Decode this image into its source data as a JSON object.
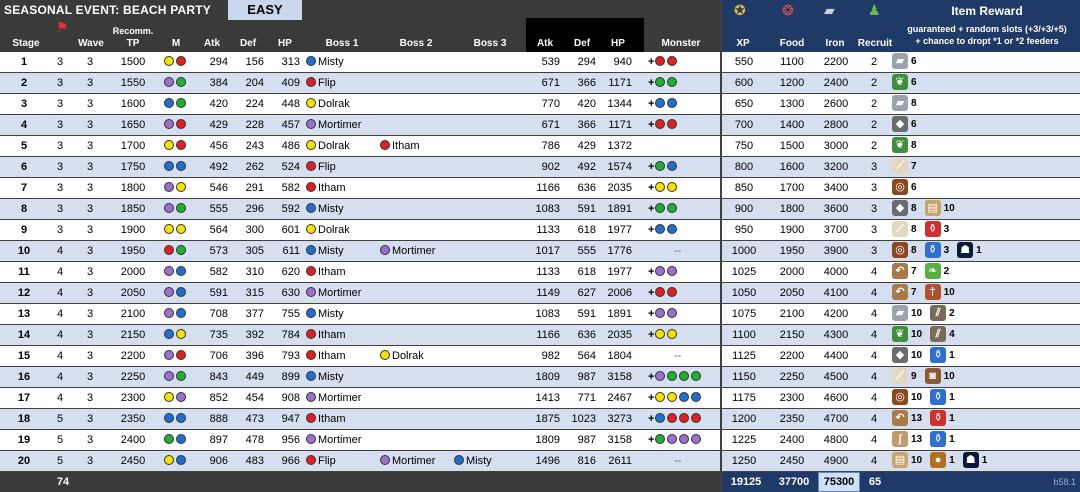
{
  "header": {
    "title": "SEASONAL EVENT:  BEACH PARTY",
    "difficulty": "EASY",
    "columns": {
      "stage": "Stage",
      "wave": "Wave",
      "recomm_top": "Recomm.",
      "recomm_bottom": "TP",
      "m": "M",
      "atk": "Atk",
      "def": "Def",
      "hp": "HP",
      "boss1": "Boss 1",
      "boss2": "Boss 2",
      "boss3": "Boss 3",
      "atk2": "Atk",
      "def2": "Def",
      "hp2": "HP",
      "monster": "Monster",
      "xp": "XP",
      "food": "Food",
      "iron": "Iron",
      "recruit": "Recruit",
      "item_reward": "Item Reward",
      "reward_note1": "guaranteed + random slots (+3/+3/+5)",
      "reward_note2": "+ chance to dropt *1 or *2 feeders"
    },
    "icons": [
      "xp-icon",
      "food-icon",
      "iron-icon",
      "recruit-icon",
      "stage-icon"
    ]
  },
  "colors": {
    "red": "#e02020",
    "green": "#20b030",
    "blue": "#1f6fd0",
    "yellow": "#f5e000",
    "purple": "#9b6fd0"
  },
  "rows": [
    {
      "stage": "1",
      "c1": "3",
      "wave": "3",
      "tp": "1500",
      "m": [
        "yellow",
        "red"
      ],
      "atk": "294",
      "def": "156",
      "hp": "313",
      "b1": {
        "n": "Misty",
        "c": "blue"
      },
      "b2": null,
      "b3": null,
      "atk2": "539",
      "def2": "294",
      "hp2": "940",
      "mon": [
        "red",
        "red"
      ],
      "mplus": true,
      "xp": "550",
      "food": "1100",
      "iron": "2200",
      "rec": "2",
      "items": [
        {
          "i": "iron-ore",
          "q": "6"
        }
      ]
    },
    {
      "stage": "2",
      "c1": "3",
      "wave": "3",
      "tp": "1550",
      "m": [
        "purple",
        "green"
      ],
      "atk": "384",
      "def": "204",
      "hp": "409",
      "b1": {
        "n": "Flip",
        "c": "red"
      },
      "b2": null,
      "b3": null,
      "atk2": "671",
      "def2": "366",
      "hp2": "1171",
      "mon": [
        "green",
        "green"
      ],
      "mplus": true,
      "xp": "600",
      "food": "1200",
      "iron": "2400",
      "rec": "2",
      "items": [
        {
          "i": "herb",
          "q": "6"
        }
      ]
    },
    {
      "stage": "3",
      "c1": "3",
      "wave": "3",
      "tp": "1600",
      "m": [
        "blue",
        "green"
      ],
      "atk": "420",
      "def": "224",
      "hp": "448",
      "b1": {
        "n": "Dolrak",
        "c": "yellow"
      },
      "b2": null,
      "b3": null,
      "atk2": "770",
      "def2": "420",
      "hp2": "1344",
      "mon": [
        "blue",
        "blue"
      ],
      "mplus": true,
      "xp": "650",
      "food": "1300",
      "iron": "2600",
      "rec": "2",
      "items": [
        {
          "i": "iron-ore",
          "q": "8"
        }
      ]
    },
    {
      "stage": "4",
      "c1": "3",
      "wave": "3",
      "tp": "1650",
      "m": [
        "purple",
        "red"
      ],
      "atk": "429",
      "def": "228",
      "hp": "457",
      "b1": {
        "n": "Mortimer",
        "c": "purple"
      },
      "b2": null,
      "b3": null,
      "atk2": "671",
      "def2": "366",
      "hp2": "1171",
      "mon": [
        "red",
        "red"
      ],
      "mplus": true,
      "xp": "700",
      "food": "1400",
      "iron": "2800",
      "rec": "2",
      "items": [
        {
          "i": "stone",
          "q": "6"
        }
      ]
    },
    {
      "stage": "5",
      "c1": "3",
      "wave": "3",
      "tp": "1700",
      "m": [
        "yellow",
        "red"
      ],
      "atk": "456",
      "def": "243",
      "hp": "486",
      "b1": {
        "n": "Dolrak",
        "c": "yellow"
      },
      "b2": {
        "n": "Itham",
        "c": "red"
      },
      "b3": null,
      "atk2": "786",
      "def2": "429",
      "hp2": "1372",
      "mon": [],
      "mplus": false,
      "xp": "750",
      "food": "1500",
      "iron": "3000",
      "rec": "2",
      "items": [
        {
          "i": "herb",
          "q": "8"
        }
      ]
    },
    {
      "stage": "6",
      "c1": "3",
      "wave": "3",
      "tp": "1750",
      "m": [
        "blue",
        "blue"
      ],
      "atk": "492",
      "def": "262",
      "hp": "524",
      "b1": {
        "n": "Flip",
        "c": "red"
      },
      "b2": null,
      "b3": null,
      "atk2": "902",
      "def2": "492",
      "hp2": "1574",
      "mon": [
        "green",
        "blue"
      ],
      "mplus": true,
      "xp": "800",
      "food": "1600",
      "iron": "3200",
      "rec": "3",
      "items": [
        {
          "i": "bone",
          "q": "7"
        }
      ]
    },
    {
      "stage": "7",
      "c1": "3",
      "wave": "3",
      "tp": "1800",
      "m": [
        "purple",
        "yellow"
      ],
      "atk": "546",
      "def": "291",
      "hp": "582",
      "b1": {
        "n": "Itham",
        "c": "red"
      },
      "b2": null,
      "b3": null,
      "atk2": "1166",
      "def2": "636",
      "hp2": "2035",
      "mon": [
        "yellow",
        "yellow"
      ],
      "mplus": true,
      "xp": "850",
      "food": "1700",
      "iron": "3400",
      "rec": "3",
      "items": [
        {
          "i": "ring",
          "q": "6"
        }
      ]
    },
    {
      "stage": "8",
      "c1": "3",
      "wave": "3",
      "tp": "1850",
      "m": [
        "purple",
        "green"
      ],
      "atk": "555",
      "def": "296",
      "hp": "592",
      "b1": {
        "n": "Misty",
        "c": "blue"
      },
      "b2": null,
      "b3": null,
      "atk2": "1083",
      "def2": "591",
      "hp2": "1891",
      "mon": [
        "green",
        "green"
      ],
      "mplus": true,
      "xp": "900",
      "food": "1800",
      "iron": "3600",
      "rec": "3",
      "items": [
        {
          "i": "stone",
          "q": "8"
        },
        {
          "i": "book",
          "q": "10"
        }
      ]
    },
    {
      "stage": "9",
      "c1": "3",
      "wave": "3",
      "tp": "1900",
      "m": [
        "yellow",
        "yellow"
      ],
      "atk": "564",
      "def": "300",
      "hp": "601",
      "b1": {
        "n": "Dolrak",
        "c": "yellow"
      },
      "b2": null,
      "b3": null,
      "atk2": "1133",
      "def2": "618",
      "hp2": "1977",
      "mon": [
        "blue",
        "blue"
      ],
      "mplus": true,
      "xp": "950",
      "food": "1900",
      "iron": "3700",
      "rec": "3",
      "items": [
        {
          "i": "bone",
          "q": "8"
        },
        {
          "i": "potion-red",
          "q": "3"
        }
      ]
    },
    {
      "stage": "10",
      "c1": "4",
      "wave": "3",
      "tp": "1950",
      "m": [
        "red",
        "green"
      ],
      "atk": "573",
      "def": "305",
      "hp": "611",
      "b1": {
        "n": "Misty",
        "c": "blue"
      },
      "b2": {
        "n": "Mortimer",
        "c": "purple"
      },
      "b3": null,
      "atk2": "1017",
      "def2": "555",
      "hp2": "1776",
      "mon": [],
      "mplus": false,
      "mdash": "--",
      "xp": "1000",
      "food": "1950",
      "iron": "3900",
      "rec": "3",
      "items": [
        {
          "i": "ring",
          "q": "8"
        },
        {
          "i": "potion-blue",
          "q": "3"
        },
        {
          "i": "hooded-figure",
          "q": "1"
        }
      ]
    },
    {
      "stage": "11",
      "c1": "4",
      "wave": "3",
      "tp": "2000",
      "m": [
        "purple",
        "blue"
      ],
      "atk": "582",
      "def": "310",
      "hp": "620",
      "b1": {
        "n": "Itham",
        "c": "red"
      },
      "b2": null,
      "b3": null,
      "atk2": "1133",
      "def2": "618",
      "hp2": "1977",
      "mon": [
        "purple",
        "purple"
      ],
      "mplus": true,
      "xp": "1025",
      "food": "2000",
      "iron": "4000",
      "rec": "4",
      "items": [
        {
          "i": "horn",
          "q": "7"
        },
        {
          "i": "leaves",
          "q": "2"
        }
      ]
    },
    {
      "stage": "12",
      "c1": "4",
      "wave": "3",
      "tp": "2050",
      "m": [
        "purple",
        "blue"
      ],
      "atk": "591",
      "def": "315",
      "hp": "630",
      "b1": {
        "n": "Mortimer",
        "c": "purple"
      },
      "b2": null,
      "b3": null,
      "atk2": "1149",
      "def2": "627",
      "hp2": "2006",
      "mon": [
        "red",
        "red"
      ],
      "mplus": true,
      "xp": "1050",
      "food": "2050",
      "iron": "4100",
      "rec": "4",
      "items": [
        {
          "i": "horn",
          "q": "7"
        },
        {
          "i": "dagger",
          "q": "10"
        }
      ]
    },
    {
      "stage": "13",
      "c1": "4",
      "wave": "3",
      "tp": "2100",
      "m": [
        "purple",
        "blue"
      ],
      "atk": "708",
      "def": "377",
      "hp": "755",
      "b1": {
        "n": "Misty",
        "c": "blue"
      },
      "b2": null,
      "b3": null,
      "atk2": "1083",
      "def2": "591",
      "hp2": "1891",
      "mon": [
        "purple",
        "purple"
      ],
      "mplus": true,
      "xp": "1075",
      "food": "2100",
      "iron": "4200",
      "rec": "4",
      "items": [
        {
          "i": "iron-ore",
          "q": "10"
        },
        {
          "i": "spears",
          "q": "2"
        }
      ]
    },
    {
      "stage": "14",
      "c1": "4",
      "wave": "3",
      "tp": "2150",
      "m": [
        "blue",
        "yellow"
      ],
      "atk": "735",
      "def": "392",
      "hp": "784",
      "b1": {
        "n": "Itham",
        "c": "red"
      },
      "b2": null,
      "b3": null,
      "atk2": "1166",
      "def2": "636",
      "hp2": "2035",
      "mon": [
        "yellow",
        "yellow"
      ],
      "mplus": true,
      "xp": "1100",
      "food": "2150",
      "iron": "4300",
      "rec": "4",
      "items": [
        {
          "i": "herb",
          "q": "10"
        },
        {
          "i": "spears",
          "q": "4"
        }
      ]
    },
    {
      "stage": "15",
      "c1": "4",
      "wave": "3",
      "tp": "2200",
      "m": [
        "purple",
        "red"
      ],
      "atk": "706",
      "def": "396",
      "hp": "793",
      "b1": {
        "n": "Itham",
        "c": "red"
      },
      "b2": {
        "n": "Dolrak",
        "c": "yellow"
      },
      "b3": null,
      "atk2": "982",
      "def2": "564",
      "hp2": "1804",
      "mon": [],
      "mplus": false,
      "mdash": "--",
      "xp": "1125",
      "food": "2200",
      "iron": "4400",
      "rec": "4",
      "items": [
        {
          "i": "stone",
          "q": "10"
        },
        {
          "i": "potion-blue",
          "q": "1"
        }
      ]
    },
    {
      "stage": "16",
      "c1": "4",
      "wave": "3",
      "tp": "2250",
      "m": [
        "purple",
        "green"
      ],
      "atk": "843",
      "def": "449",
      "hp": "899",
      "b1": {
        "n": "Misty",
        "c": "blue"
      },
      "b2": null,
      "b3": null,
      "atk2": "1809",
      "def2": "987",
      "hp2": "3158",
      "mon": [
        "purple",
        "green",
        "green",
        "green"
      ],
      "mplus": true,
      "xp": "1150",
      "food": "2250",
      "iron": "4500",
      "rec": "4",
      "items": [
        {
          "i": "bone",
          "q": "9"
        },
        {
          "i": "backpack",
          "q": "10"
        }
      ]
    },
    {
      "stage": "17",
      "c1": "4",
      "wave": "3",
      "tp": "2300",
      "m": [
        "yellow",
        "purple"
      ],
      "atk": "852",
      "def": "454",
      "hp": "908",
      "b1": {
        "n": "Mortimer",
        "c": "purple"
      },
      "b2": null,
      "b3": null,
      "atk2": "1413",
      "def2": "771",
      "hp2": "2467",
      "mon": [
        "yellow",
        "yellow",
        "blue",
        "blue"
      ],
      "mplus": true,
      "xp": "1175",
      "food": "2300",
      "iron": "4600",
      "rec": "4",
      "items": [
        {
          "i": "ring",
          "q": "10"
        },
        {
          "i": "potion-blue",
          "q": "1"
        }
      ]
    },
    {
      "stage": "18",
      "c1": "5",
      "wave": "3",
      "tp": "2350",
      "m": [
        "blue",
        "blue"
      ],
      "atk": "888",
      "def": "473",
      "hp": "947",
      "b1": {
        "n": "Itham",
        "c": "red"
      },
      "b2": null,
      "b3": null,
      "atk2": "1875",
      "def2": "1023",
      "hp2": "3273",
      "mon": [
        "blue",
        "red",
        "red",
        "red"
      ],
      "mplus": true,
      "xp": "1200",
      "food": "2350",
      "iron": "4700",
      "rec": "4",
      "items": [
        {
          "i": "horn",
          "q": "13"
        },
        {
          "i": "potion-red",
          "q": "1"
        }
      ]
    },
    {
      "stage": "19",
      "c1": "5",
      "wave": "3",
      "tp": "2400",
      "m": [
        "green",
        "blue"
      ],
      "atk": "897",
      "def": "478",
      "hp": "956",
      "b1": {
        "n": "Mortimer",
        "c": "purple"
      },
      "b2": null,
      "b3": null,
      "atk2": "1809",
      "def2": "987",
      "hp2": "3158",
      "mon": [
        "green",
        "purple",
        "purple",
        "purple"
      ],
      "mplus": true,
      "xp": "1225",
      "food": "2400",
      "iron": "4800",
      "rec": "4",
      "items": [
        {
          "i": "hook",
          "q": "13"
        },
        {
          "i": "potion-blue",
          "q": "1"
        }
      ]
    },
    {
      "stage": "20",
      "c1": "5",
      "wave": "3",
      "tp": "2450",
      "m": [
        "yellow",
        "blue"
      ],
      "atk": "906",
      "def": "483",
      "hp": "966",
      "b1": {
        "n": "Flip",
        "c": "red"
      },
      "b2": {
        "n": "Mortimer",
        "c": "purple"
      },
      "b3": {
        "n": "Misty",
        "c": "blue"
      },
      "atk2": "1496",
      "def2": "816",
      "hp2": "2611",
      "mon": [],
      "mplus": false,
      "mdash": "--",
      "xp": "1250",
      "food": "2450",
      "iron": "4900",
      "rec": "4",
      "items": [
        {
          "i": "book",
          "q": "10"
        },
        {
          "i": "orb",
          "q": "1"
        },
        {
          "i": "hooded-figure",
          "q": "1"
        }
      ]
    }
  ],
  "footer": {
    "stage_total": "74",
    "xp_total": "19125",
    "food_total": "37700",
    "iron_total": "75300",
    "recruit_total": "65",
    "version": "b58.1"
  },
  "item_styles": {
    "iron-ore": {
      "bg": "#9aa4ae",
      "glyph": "▰"
    },
    "herb": {
      "bg": "#3f8f3a",
      "glyph": "❦"
    },
    "stone": {
      "bg": "#6b6b6b",
      "glyph": "◆"
    },
    "bone": {
      "bg": "#e4d7bf",
      "glyph": "⟋"
    },
    "ring": {
      "bg": "#8a4a20",
      "glyph": "◎"
    },
    "book": {
      "bg": "#c8a46a",
      "glyph": "▤"
    },
    "potion-red": {
      "bg": "#d03030",
      "glyph": "⚱"
    },
    "potion-blue": {
      "bg": "#2f6fd0",
      "glyph": "⚱"
    },
    "hooded-figure": {
      "bg": "#0a1a3a",
      "glyph": "☗"
    },
    "horn": {
      "bg": "#a87a48",
      "glyph": "↶"
    },
    "leaves": {
      "bg": "#58b040",
      "glyph": "❧"
    },
    "dagger": {
      "bg": "#b05030",
      "glyph": "†"
    },
    "spears": {
      "bg": "#7a6a5a",
      "glyph": "⫽"
    },
    "backpack": {
      "bg": "#8a5a30",
      "glyph": "◙"
    },
    "hook": {
      "bg": "#c49a6a",
      "glyph": "ʃ"
    },
    "orb": {
      "bg": "#b07020",
      "glyph": "●"
    }
  }
}
